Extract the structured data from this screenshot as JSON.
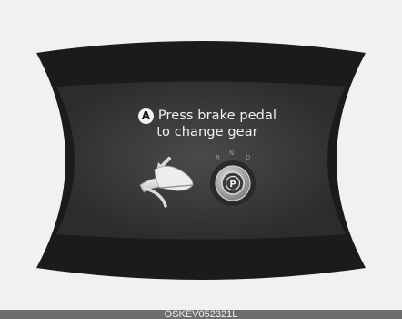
{
  "cluster": {
    "marker": "A",
    "message_line1": "Press brake pedal",
    "message_line2": "to change gear",
    "gear_letters": [
      "R",
      "N",
      "D"
    ],
    "park_letter": "P",
    "icons": [
      "brake-pedal-icon",
      "gear-selector-icon"
    ]
  },
  "caption": {
    "code": "OSKEV052321L"
  }
}
